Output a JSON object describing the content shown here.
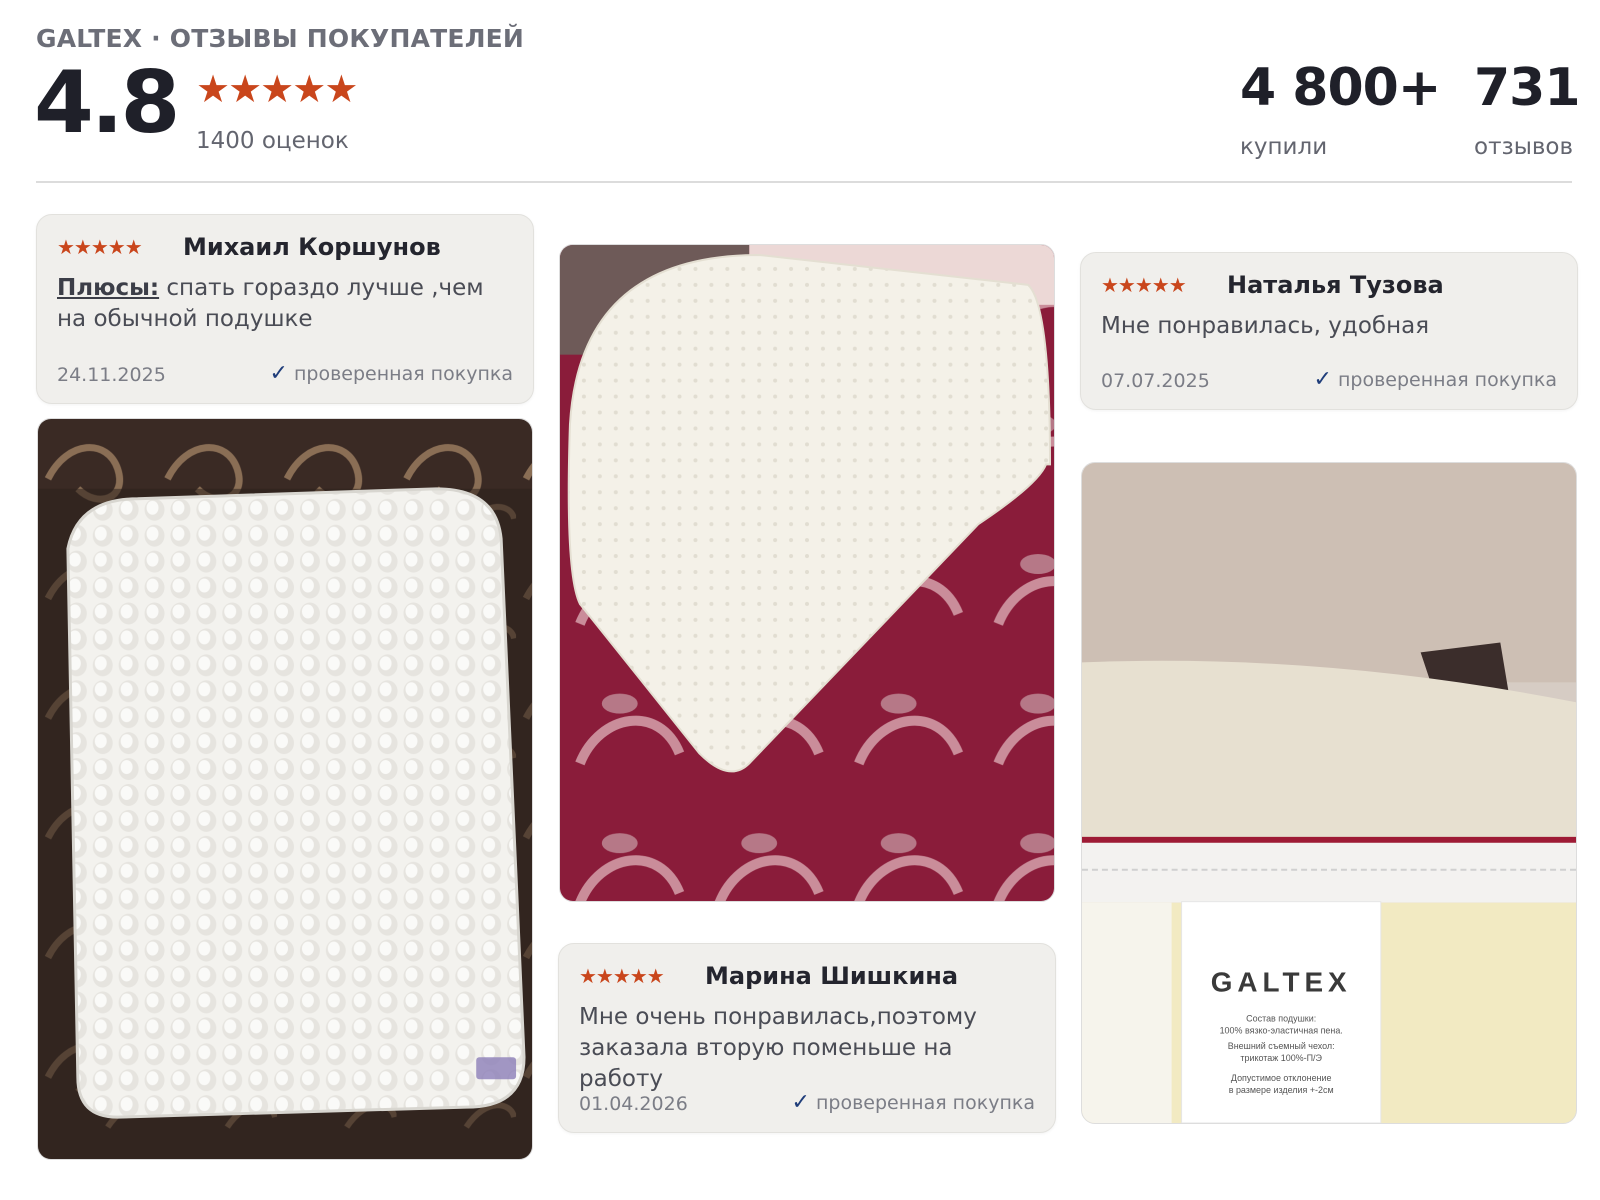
{
  "header": {
    "brand_line": "GALTEX · ОТЗЫВЫ ПОКУПАТЕЛЕЙ",
    "rating": "4.8",
    "stars": "★★★★★",
    "ratings_count": "1400 оценок",
    "bought_value": "4 800+",
    "bought_label": "купили",
    "reviews_value": "731",
    "reviews_label": "отзывов"
  },
  "reviews": [
    {
      "stars": "★★★★★",
      "author": "Михаил Коршунов",
      "pros_label": "Плюсы:",
      "text": " спать гораздо лучше ,чем на обычной подушке",
      "date": "24.11.2025",
      "verified": "проверенная покупка"
    },
    {
      "stars": "★★★★★",
      "author": "Наталья Тузова",
      "text": "Мне понравилась, удобная",
      "date": "07.07.2025",
      "verified": "проверенная покупка"
    },
    {
      "stars": "★★★★★",
      "author": "Марина Шишкина",
      "text": "Мне очень понравилась,поэтому заказала вторую поменьше на работу",
      "date": "01.04.2026",
      "verified": "проверенная покупка"
    }
  ],
  "photos": {
    "label_brand": "GALTEX",
    "label_text": [
      "Состав подушки:",
      "100% вязко-эластичная пена.",
      "Внешний съемный чехол:",
      "трикотаж 100%-П/Э",
      "Допустимое отклонение",
      "в размере изделия +-2см"
    ]
  },
  "colors": {
    "star": "#c9461c",
    "check": "#1f3d7a",
    "card_bg": "#f0efec"
  }
}
